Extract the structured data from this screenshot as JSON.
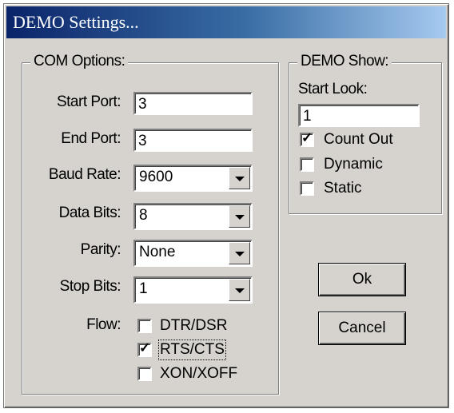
{
  "window": {
    "title": "DEMO Settings..."
  },
  "com_options": {
    "legend": "COM Options:",
    "start_port": {
      "label": "Start Port:",
      "value": "3"
    },
    "end_port": {
      "label": "End Port:",
      "value": "3"
    },
    "baud_rate": {
      "label": "Baud Rate:",
      "value": "9600"
    },
    "data_bits": {
      "label": "Data Bits:",
      "value": "8"
    },
    "parity": {
      "label": "Parity:",
      "value": "None"
    },
    "stop_bits": {
      "label": "Stop Bits:",
      "value": "1"
    },
    "flow": {
      "label": "Flow:",
      "options": [
        {
          "label": "DTR/DSR",
          "checked": false
        },
        {
          "label": "RTS/CTS",
          "checked": true
        },
        {
          "label": "XON/XOFF",
          "checked": false
        }
      ]
    }
  },
  "demo_show": {
    "legend": "DEMO Show:",
    "start_look": {
      "label": "Start Look:",
      "value": "1"
    },
    "options": [
      {
        "label": "Count Out",
        "checked": true
      },
      {
        "label": "Dynamic",
        "checked": false
      },
      {
        "label": "Static",
        "checked": false
      }
    ]
  },
  "buttons": {
    "ok": "Ok",
    "cancel": "Cancel"
  },
  "checkmark_glyph": "✓"
}
